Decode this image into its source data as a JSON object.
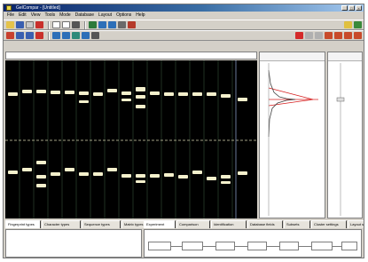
{
  "window": {
    "title": "GelCompar - [Untitled]"
  },
  "menu": [
    "File",
    "Edit",
    "View",
    "Tools",
    "Mode",
    "Database",
    "Layout",
    "Options",
    "Help"
  ],
  "toolbar1_icons": [
    "open-icon",
    "save-icon",
    "cut-icon",
    "copy-icon",
    "undo-icon",
    "print-icon",
    "print-preview-icon",
    "database-icon",
    "compare-icon",
    "cluster-icon",
    "settings-icon",
    "report-icon",
    "zoom-in-icon",
    "zoom-out-icon"
  ],
  "toolbar2_icons": [
    "image-icon",
    "lane-icon",
    "band-icon",
    "marker-icon",
    "normalize-icon",
    "grid-icon",
    "filter-icon",
    "crosshair-icon",
    "densitometry-icon",
    "stop-icon",
    "pattern-icon",
    "fit-icon",
    "export-icon",
    "tile-icon",
    "cascade-icon",
    "close-icon"
  ],
  "colors": {
    "gel_background": "#000000",
    "band": "#f4f0cc",
    "accent_titlebar": "#0a246a"
  },
  "bottom_tabs_left": [
    "Fingerprint types",
    "Character types",
    "Sequence types",
    "Matrix types"
  ],
  "bottom_tabs_right": [
    "Experiment",
    "Comparison",
    "Identification",
    "Database fields",
    "Subsets",
    "Cluster settings",
    "Layout settings"
  ]
}
